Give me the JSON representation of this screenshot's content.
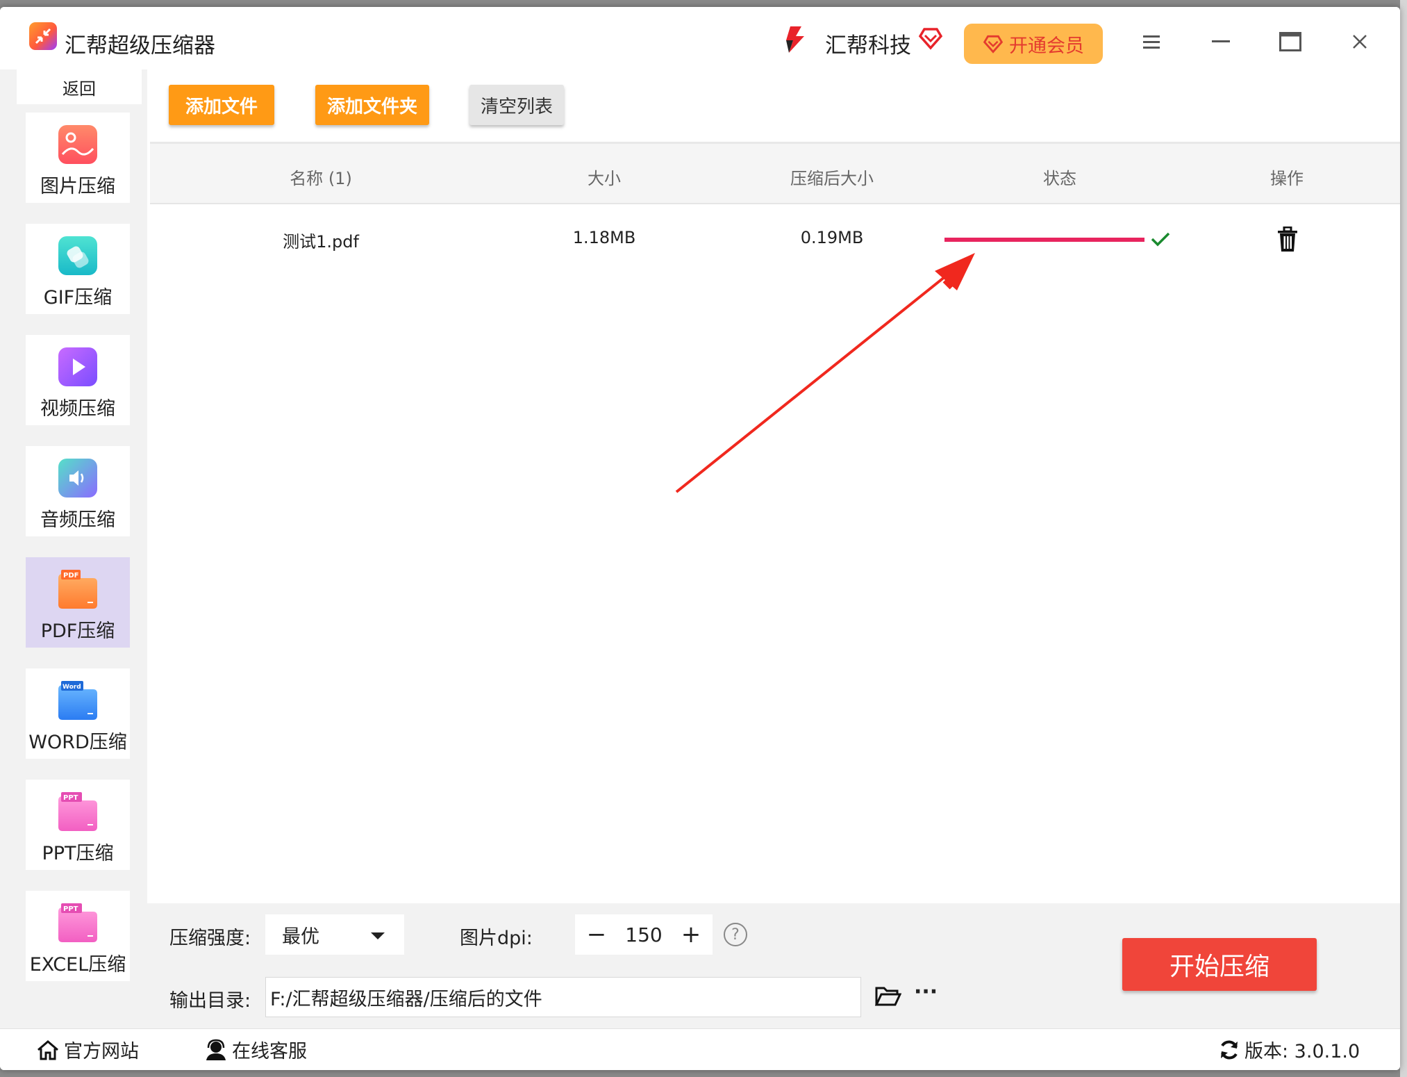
{
  "window": {
    "title": "汇帮超级压缩器",
    "brand": "汇帮科技",
    "vip_label": "开通会员"
  },
  "sidebar": {
    "back_label": "返回",
    "items": [
      {
        "label": "图片压缩",
        "icon": "image-icon"
      },
      {
        "label": "GIF压缩",
        "icon": "gif-icon"
      },
      {
        "label": "视频压缩",
        "icon": "video-icon"
      },
      {
        "label": "音频压缩",
        "icon": "audio-icon"
      },
      {
        "label": "PDF压缩",
        "icon": "pdf-icon",
        "active": true
      },
      {
        "label": "WORD压缩",
        "icon": "word-icon"
      },
      {
        "label": "PPT压缩",
        "icon": "ppt-icon"
      },
      {
        "label": "EXCEL压缩",
        "icon": "excel-icon"
      }
    ]
  },
  "toolbar": {
    "add_file": "添加文件",
    "add_folder": "添加文件夹",
    "clear_list": "清空列表"
  },
  "table": {
    "columns": [
      "名称 (1)",
      "大小",
      "压缩后大小",
      "状态",
      "操作"
    ],
    "rows": [
      {
        "name": "测试1.pdf",
        "size": "1.18MB",
        "compressed_size": "0.19MB",
        "progress": 1.0,
        "status": "done"
      }
    ]
  },
  "settings": {
    "strength_label": "压缩强度:",
    "strength_value": "最优",
    "dpi_label": "图片dpi:",
    "dpi_value": "150",
    "dpi_minus": "−",
    "dpi_plus": "+",
    "help": "?",
    "output_label": "输出目录:",
    "output_path": "F:/汇帮超级压缩器/压缩后的文件",
    "more": "···",
    "start_label": "开始压缩"
  },
  "statusbar": {
    "website": "官方网站",
    "support": "在线客服",
    "version": "版本: 3.0.1.0"
  },
  "colors": {
    "accent_orange": "#ff9a15",
    "start_red": "#f0453a",
    "progress_pink": "#e8245e",
    "check_green": "#1a8a2e",
    "vip_bg": "#ffb84d"
  }
}
